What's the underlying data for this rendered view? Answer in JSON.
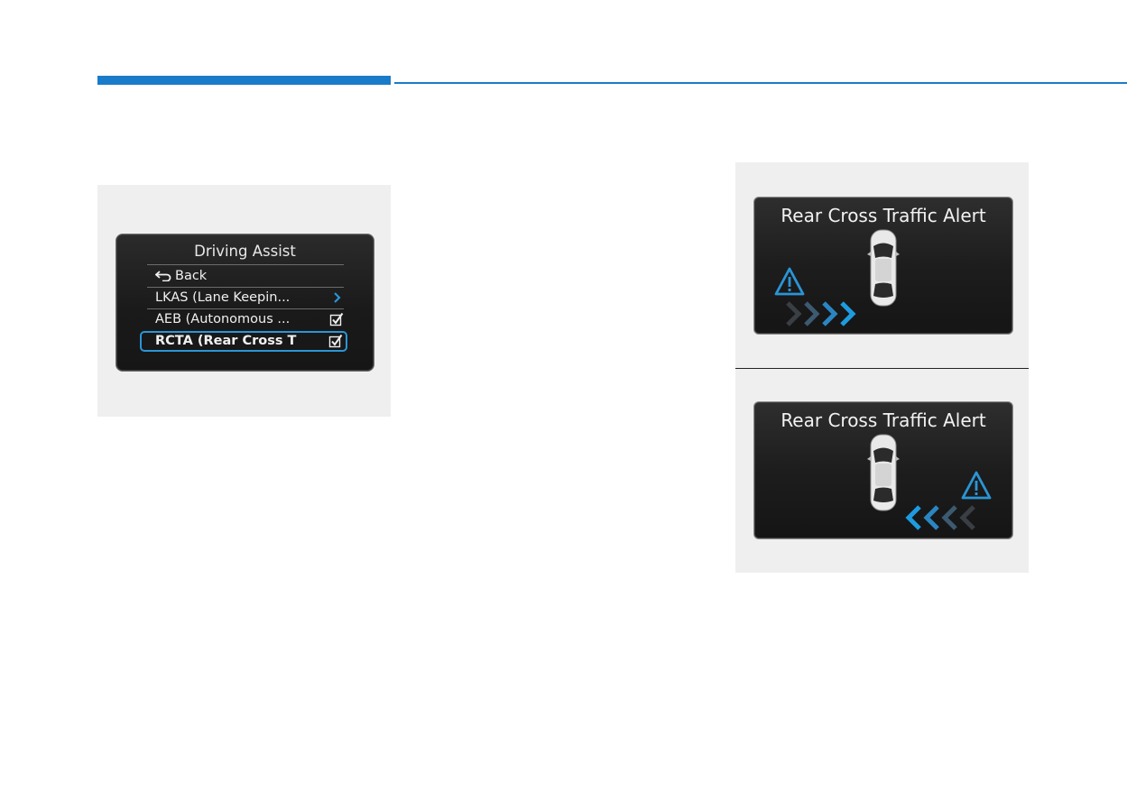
{
  "menu": {
    "title": "Driving Assist",
    "back_label": "Back",
    "items": [
      {
        "label": "LKAS (Lane Keepin...",
        "control": "chevron"
      },
      {
        "label": "AEB (Autonomous ...",
        "control": "checkbox",
        "checked": true
      },
      {
        "label": "RCTA (Rear Cross T",
        "control": "checkbox",
        "checked": true,
        "selected": true
      }
    ]
  },
  "alerts": [
    {
      "title": "Rear Cross Traffic Alert",
      "direction": "right",
      "warning_icon": "warning-triangle-icon"
    },
    {
      "title": "Rear Cross Traffic Alert",
      "direction": "left",
      "warning_icon": "warning-triangle-icon"
    }
  ],
  "colors": {
    "accent": "#1a7bc9",
    "highlight": "#2a95d6",
    "screen_bg": "#1d1d1d"
  }
}
